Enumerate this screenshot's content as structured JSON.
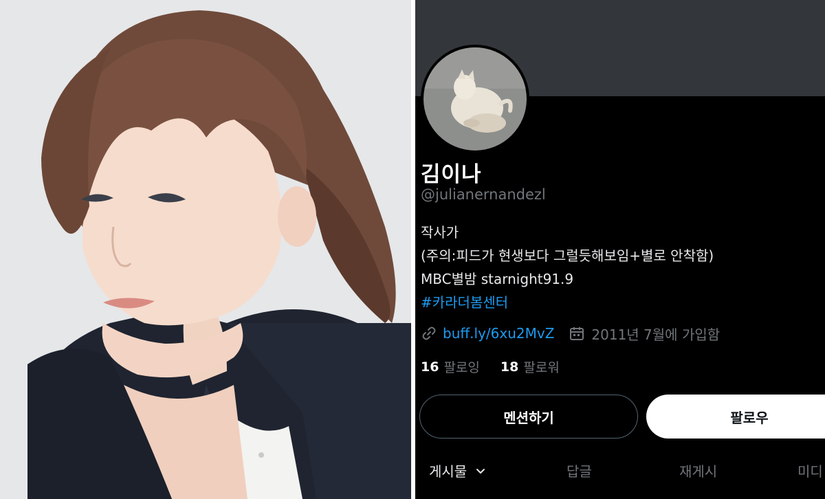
{
  "profile": {
    "display_name": "김이나",
    "handle": "@julianernandezl",
    "bio": {
      "line1": "작사가",
      "line2": "(주의:피드가 현생보다 그럴듯해보임+별로 안착함)",
      "line3": "MBC별밤 starnight91.9",
      "hashtag": "#카라더봄센터"
    },
    "website": "buff.ly/6xu2MvZ",
    "joined": "2011년 7월에 가입함",
    "stats": {
      "following_count": "16",
      "following_label": "팔로잉",
      "followers_count": "18",
      "followers_label": "팔로워"
    },
    "buttons": {
      "mention": "멘션하기",
      "follow": "팔로우"
    },
    "tabs": [
      "게시물",
      "답글",
      "재게시",
      "미디"
    ]
  },
  "colors": {
    "background": "#000000",
    "banner": "#33363b",
    "link": "#1d9bf0",
    "muted_text": "#71767b",
    "primary_text": "#e7e9ea"
  },
  "icons": {
    "website": "link-icon",
    "joined": "calendar-icon",
    "tab_dropdown": "chevron-down-icon"
  }
}
